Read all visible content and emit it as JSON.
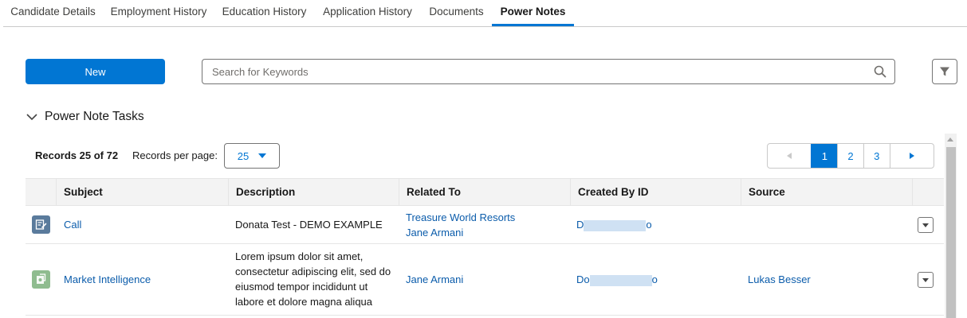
{
  "tabs": [
    {
      "label": "Candidate Details",
      "active": false
    },
    {
      "label": "Employment History",
      "active": false
    },
    {
      "label": "Education History",
      "active": false
    },
    {
      "label": "Application History",
      "active": false
    },
    {
      "label": "Documents",
      "active": false
    },
    {
      "label": "Power Notes",
      "active": true
    }
  ],
  "toolbar": {
    "new_label": "New",
    "search_placeholder": "Search for Keywords",
    "search_value": ""
  },
  "section": {
    "title": "Power Note Tasks",
    "records_text": "Records 25 of 72",
    "per_page_label": "Records per page:",
    "per_page_value": "25"
  },
  "pagination": {
    "pages": [
      "1",
      "2",
      "3"
    ],
    "active_page": "1"
  },
  "table": {
    "columns": [
      "Subject",
      "Description",
      "Related To",
      "Created By ID",
      "Source"
    ],
    "rows": [
      {
        "icon": "call-task-icon",
        "subject": "Call",
        "description": "Donata Test - DEMO EXAMPLE",
        "related_to": [
          "Treasure World Resorts",
          "Jane Armani"
        ],
        "created_by_prefix": "D",
        "created_by_suffix": "o",
        "source": ""
      },
      {
        "icon": "market-intelligence-icon",
        "subject": "Market Intelligence",
        "description": "Lorem ipsum dolor sit amet, consectetur adipiscing elit, sed do eiusmod tempor incididunt ut labore et dolore magna aliqua",
        "related_to": [
          "Jane Armani"
        ],
        "created_by_prefix": "Do",
        "created_by_suffix": "o",
        "source": "Lukas Besser"
      }
    ]
  },
  "colors": {
    "brand": "#0176d3",
    "link": "#0b5cab",
    "call_icon_bg": "#5a7b9c",
    "market_icon_bg": "#8fbc8f"
  }
}
